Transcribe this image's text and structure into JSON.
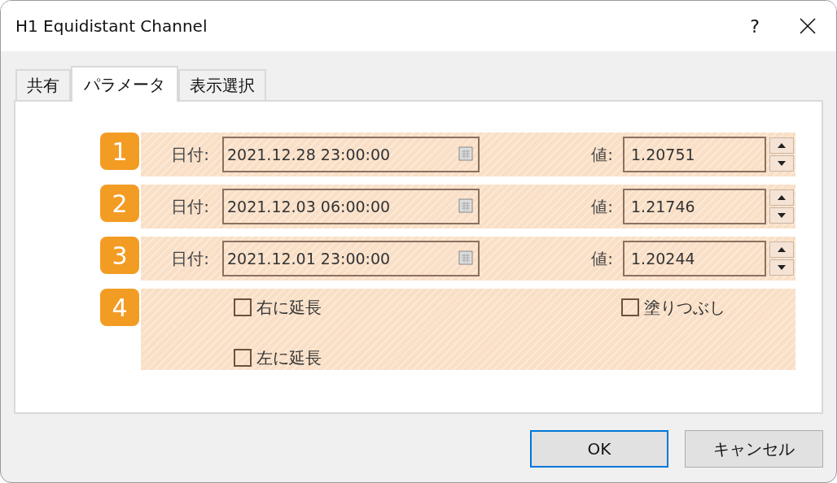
{
  "window": {
    "title": "H1 Equidistant Channel",
    "help": "?"
  },
  "tabs": [
    {
      "label": "共有",
      "selected": false
    },
    {
      "label": "パラメータ",
      "selected": true
    },
    {
      "label": "表示選択",
      "selected": false
    }
  ],
  "points": [
    {
      "badge": "1",
      "date_label": "日付:",
      "date": "2021.12.28 23:00:00",
      "value_label": "値:",
      "value": "1.20751"
    },
    {
      "badge": "2",
      "date_label": "日付:",
      "date": "2021.12.03 06:00:00",
      "value_label": "値:",
      "value": "1.21746"
    },
    {
      "badge": "3",
      "date_label": "日付:",
      "date": "2021.12.01 23:00:00",
      "value_label": "値:",
      "value": "1.20244"
    }
  ],
  "options": {
    "badge": "4",
    "checkboxes": [
      {
        "label": "右に延長",
        "checked": false
      },
      {
        "label": "左に延長",
        "checked": false
      },
      {
        "label": "塗りつぶし",
        "checked": false
      }
    ]
  },
  "buttons": [
    {
      "label": "OK",
      "default": true
    },
    {
      "label": "キャンセル",
      "default": false
    }
  ]
}
